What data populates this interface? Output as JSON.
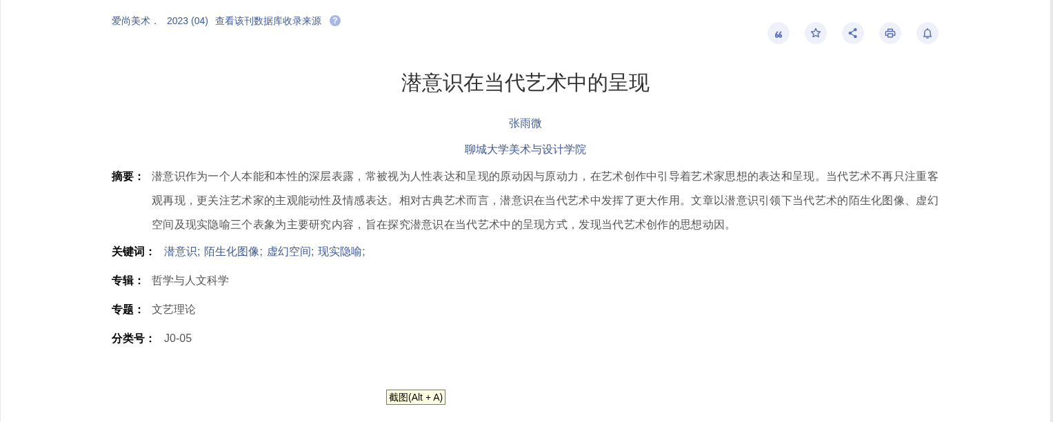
{
  "source": {
    "journal": "爱尚美术．",
    "issue": "2023 (04)",
    "link": "查看该刊数据库收录来源",
    "help_icon": "?"
  },
  "actions": [
    {
      "kind": "quote"
    },
    {
      "kind": "star"
    },
    {
      "kind": "share"
    },
    {
      "kind": "print"
    },
    {
      "kind": "bell"
    }
  ],
  "title": "潜意识在当代艺术中的呈现",
  "author": "张雨微",
  "affiliation": "聊城大学美术与设计学院",
  "abstract": {
    "label": "摘要：",
    "text": "潜意识作为一个人本能和本性的深层表露，常被视为人性表达和呈现的原动因与原动力，在艺术创作中引导着艺术家思想的表达和呈现。当代艺术不再只注重客观再现，更关注艺术家的主观能动性及情感表达。相对古典艺术而言，潜意识在当代艺术中发挥了更大作用。文章以潜意识引领下当代艺术的陌生化图像、虚幻空间及现实隐喻三个表象为主要研究内容，旨在探究潜意识在当代艺术中的呈现方式，发现当代艺术创作的思想动因。"
  },
  "keywords": {
    "label": "关键词：",
    "items": [
      "潜意识;",
      "陌生化图像;",
      "虚幻空间;",
      "现实隐喻;"
    ]
  },
  "fields": [
    {
      "label": "专辑：",
      "value": "哲学与人文科学"
    },
    {
      "label": "专题：",
      "value": "文艺理论"
    },
    {
      "label": "分类号：",
      "value": "J0-05"
    }
  ],
  "tooltip": "截图(Alt + A)"
}
